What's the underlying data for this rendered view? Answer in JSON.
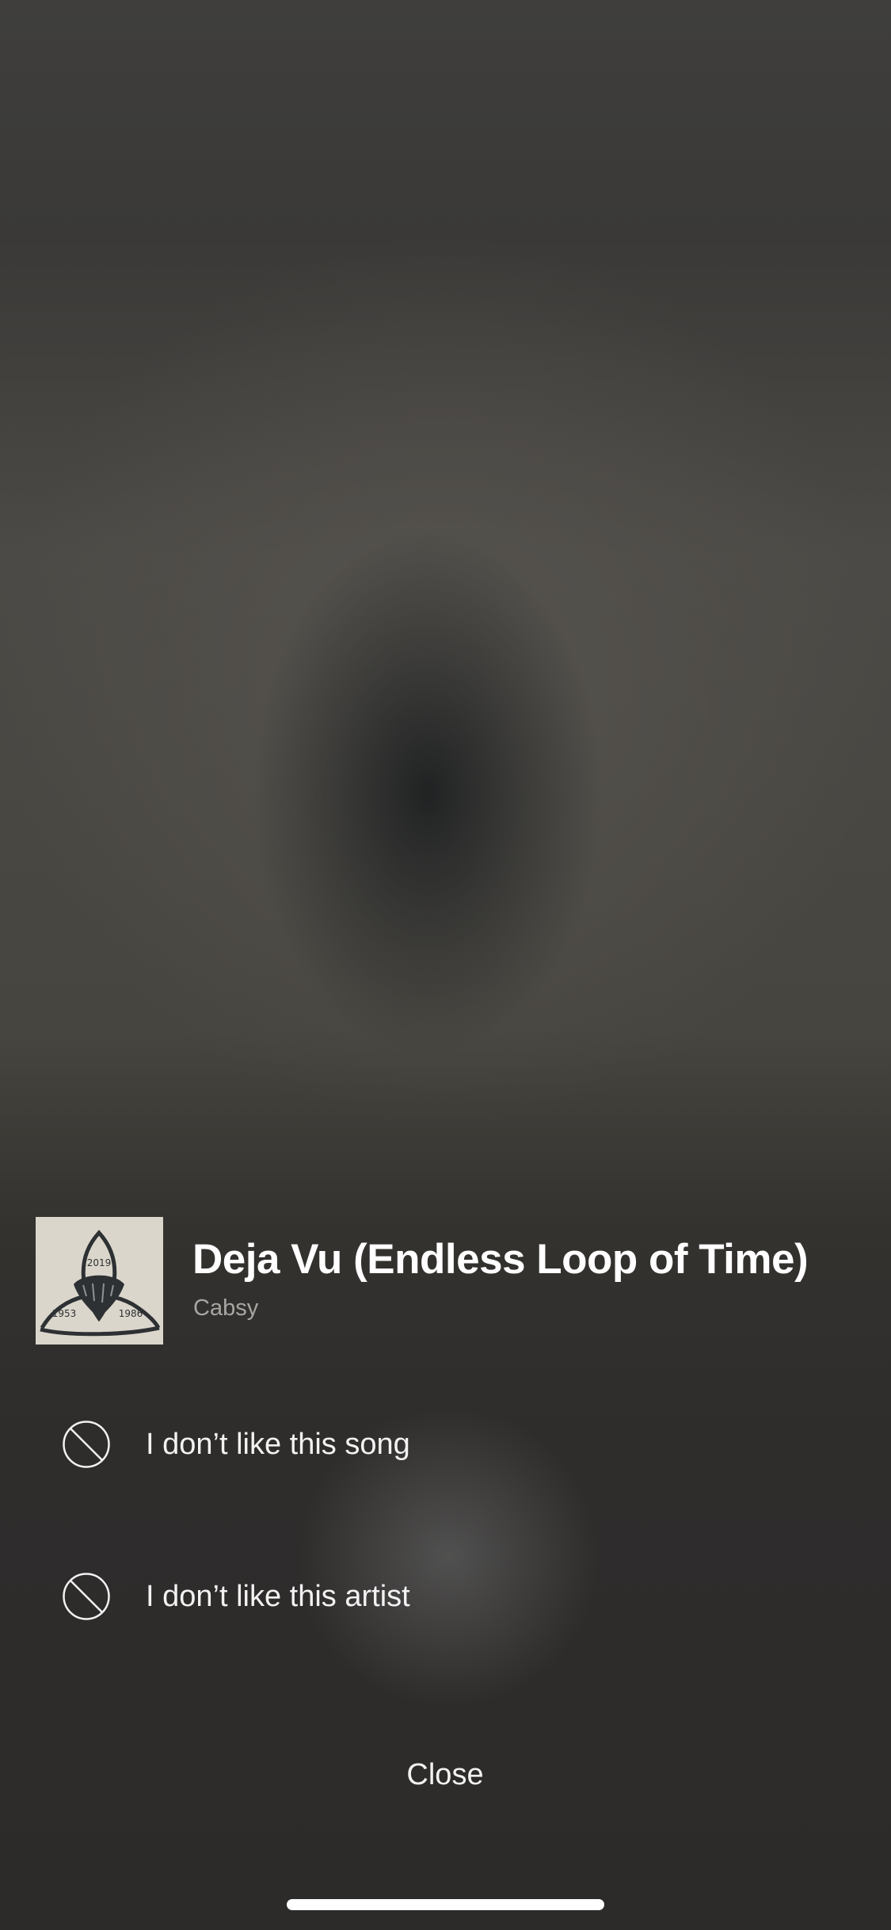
{
  "track": {
    "title": "Deja Vu (Endless Loop of Time)",
    "artist": "Cabsy",
    "artwork": {
      "top_year": "2019",
      "left_year": "1953",
      "right_year": "1986"
    }
  },
  "options": [
    {
      "label": "I don’t like this song",
      "icon": "block-icon"
    },
    {
      "label": "I don’t like this artist",
      "icon": "block-icon"
    }
  ],
  "close_label": "Close",
  "colors": {
    "background": "#2b2a29",
    "text_primary": "#ffffff",
    "text_secondary": "#a8a6a2"
  }
}
